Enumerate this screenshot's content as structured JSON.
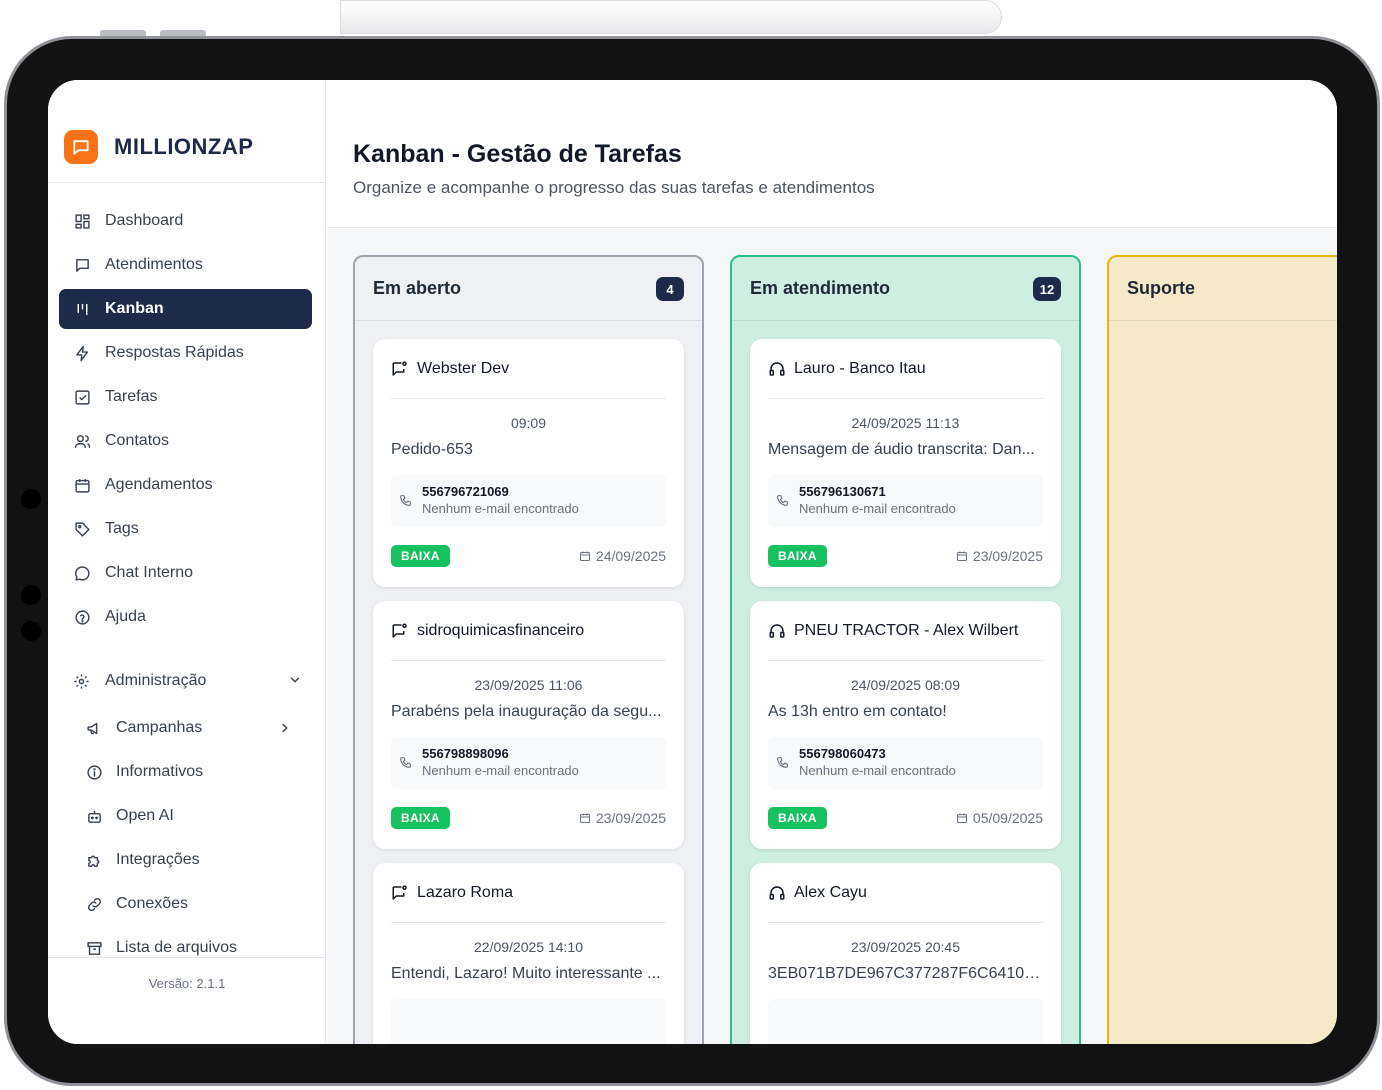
{
  "brand": {
    "name": "MILLIONZAP",
    "accent": "#f97316",
    "navy": "#1e2a4a"
  },
  "sidebar": {
    "items": [
      {
        "label": "Dashboard",
        "icon": "dashboard-icon"
      },
      {
        "label": "Atendimentos",
        "icon": "message-square-icon"
      },
      {
        "label": "Kanban",
        "icon": "kanban-icon",
        "active": true
      },
      {
        "label": "Respostas Rápidas",
        "icon": "zap-icon"
      },
      {
        "label": "Tarefas",
        "icon": "checkbox-icon"
      },
      {
        "label": "Contatos",
        "icon": "users-icon"
      },
      {
        "label": "Agendamentos",
        "icon": "calendar-icon"
      },
      {
        "label": "Tags",
        "icon": "tag-icon"
      },
      {
        "label": "Chat Interno",
        "icon": "chat-bubble-icon"
      },
      {
        "label": "Ajuda",
        "icon": "help-circle-icon"
      }
    ],
    "admin": {
      "label": "Administração",
      "subitems": [
        {
          "label": "Campanhas"
        },
        {
          "label": "Informativos"
        },
        {
          "label": "Open AI"
        },
        {
          "label": "Integrações"
        },
        {
          "label": "Conexões"
        },
        {
          "label": "Lista de arquivos"
        }
      ]
    },
    "version": "Versão: 2.1.1"
  },
  "header": {
    "title": "Kanban - Gestão de Tarefas",
    "subtitle": "Organize e acompanhe o progresso das suas tarefas e atendimentos"
  },
  "columns": [
    {
      "title": "Em aberto",
      "count": "4",
      "colors": {
        "bg": "#eef0f3",
        "border": "#9ca3af"
      },
      "cards": [
        {
          "name": "Webster Dev",
          "time": "09:09",
          "message": "Pedido-653",
          "phone": "556796721069",
          "email": "Nenhum e-mail encontrado",
          "priority": "BAIXA",
          "date": "24/09/2025"
        },
        {
          "name": "sidroquimicasfinanceiro",
          "time": "23/09/2025 11:06",
          "message": "Parabéns pela inauguração da segu...",
          "phone": "556798898096",
          "email": "Nenhum e-mail encontrado",
          "priority": "BAIXA",
          "date": "23/09/2025"
        },
        {
          "name": "Lazaro Roma",
          "time": "22/09/2025 14:10",
          "message": "Entendi, Lazaro! Muito interessante ...",
          "phone": "",
          "email": "",
          "priority": "",
          "date": ""
        }
      ]
    },
    {
      "title": "Em atendimento",
      "count": "12",
      "colors": {
        "bg": "#cdeee1",
        "border": "#2bbd8a"
      },
      "cards": [
        {
          "name": "Lauro - Banco Itau",
          "time": "24/09/2025 11:13",
          "message": "Mensagem de áudio transcrita: Dan...",
          "phone": "556796130671",
          "email": "Nenhum e-mail encontrado",
          "priority": "BAIXA",
          "date": "23/09/2025"
        },
        {
          "name": "PNEU TRACTOR - Alex Wilbert",
          "time": "24/09/2025 08:09",
          "message": "As 13h entro em contato!",
          "phone": "556798060473",
          "email": "Nenhum e-mail encontrado",
          "priority": "BAIXA",
          "date": "05/09/2025"
        },
        {
          "name": "Alex Cayu",
          "time": "23/09/2025 20:45",
          "message": "3EB071B7DE967C377287F6C64105...",
          "phone": "",
          "email": "",
          "priority": "",
          "date": ""
        }
      ]
    },
    {
      "title": "Suporte",
      "count": "",
      "colors": {
        "bg": "#f5e9c9",
        "border": "#eab308"
      },
      "cards": []
    }
  ]
}
